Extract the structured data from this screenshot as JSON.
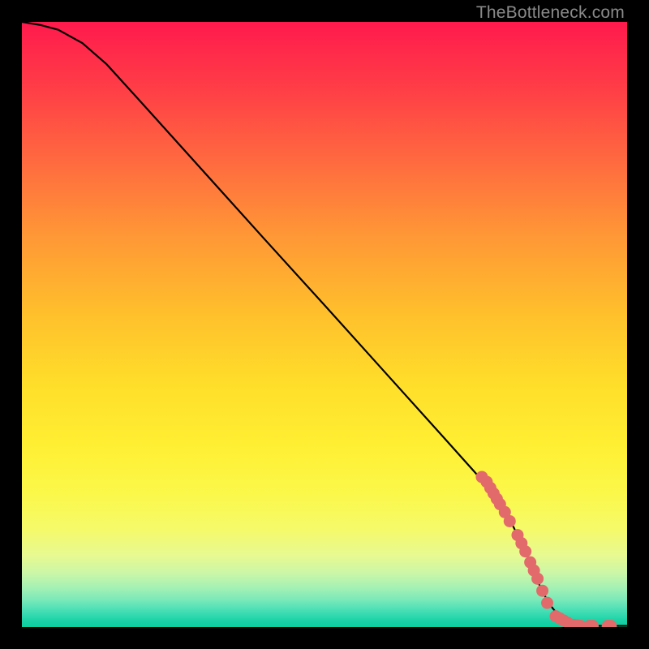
{
  "watermark": "TheBottleneck.com",
  "chart_data": {
    "type": "line",
    "title": "",
    "xlabel": "",
    "ylabel": "",
    "xlim": [
      0,
      100
    ],
    "ylim": [
      0,
      100
    ],
    "curve_xy": [
      [
        0,
        100
      ],
      [
        3,
        99.5
      ],
      [
        6,
        98.7
      ],
      [
        10,
        96.5
      ],
      [
        14,
        93.0
      ],
      [
        20,
        86.4
      ],
      [
        30,
        75.3
      ],
      [
        40,
        64.2
      ],
      [
        50,
        53.2
      ],
      [
        60,
        42.1
      ],
      [
        70,
        31.0
      ],
      [
        76,
        24.3
      ],
      [
        80,
        19.0
      ],
      [
        83,
        13.0
      ],
      [
        85,
        8.0
      ],
      [
        87,
        4.0
      ],
      [
        89,
        1.5
      ],
      [
        91,
        0.5
      ],
      [
        93,
        0.2
      ],
      [
        100,
        0.2
      ]
    ],
    "marker_clusters": [
      {
        "start_x": 76.0,
        "end_x": 76.8,
        "y_start": 24.8,
        "y_end": 24.0,
        "count": 2
      },
      {
        "start_x": 77.4,
        "end_x": 79.0,
        "y_start": 23.0,
        "y_end": 20.3,
        "count": 4
      },
      {
        "start_x": 79.8,
        "end_x": 80.6,
        "y_start": 19.0,
        "y_end": 17.5,
        "count": 2
      },
      {
        "start_x": 81.9,
        "end_x": 83.2,
        "y_start": 15.2,
        "y_end": 12.5,
        "count": 3
      },
      {
        "start_x": 84.0,
        "end_x": 85.2,
        "y_start": 10.7,
        "y_end": 8.0,
        "count": 3
      },
      {
        "start_x": 86.0,
        "end_x": 86.8,
        "y_start": 6.0,
        "y_end": 4.0,
        "count": 2
      },
      {
        "start_x": 88.2,
        "end_x": 90.2,
        "y_start": 1.8,
        "y_end": 0.7,
        "count": 4
      },
      {
        "start_x": 90.7,
        "end_x": 92.3,
        "y_start": 0.4,
        "y_end": 0.2,
        "count": 4
      },
      {
        "start_x": 93.8,
        "end_x": 94.3,
        "y_start": 0.2,
        "y_end": 0.2,
        "count": 2
      },
      {
        "start_x": 96.8,
        "end_x": 97.3,
        "y_start": 0.2,
        "y_end": 0.2,
        "count": 2
      }
    ],
    "marker_color": "#e26a6a",
    "curve_color": "#000000"
  }
}
